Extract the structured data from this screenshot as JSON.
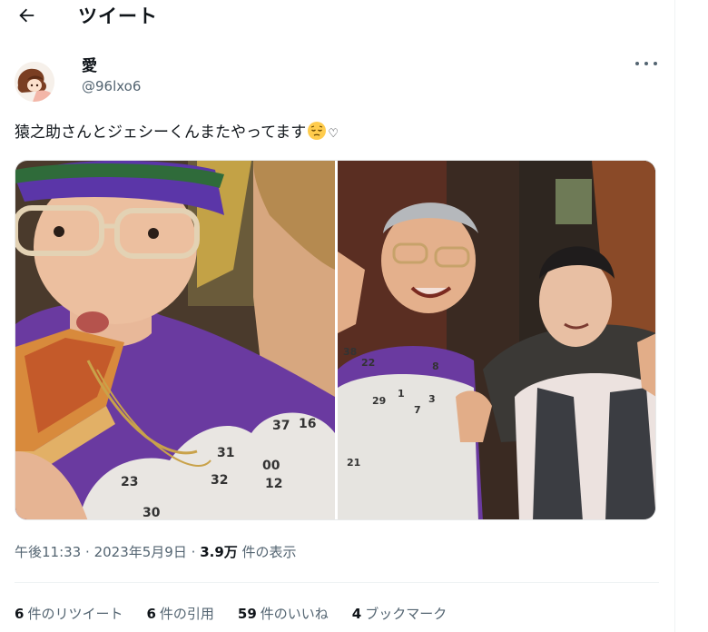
{
  "header": {
    "title": "ツイート",
    "back_icon": "arrow-left-icon"
  },
  "user": {
    "display_name": "愛",
    "handle": "@96lxo6",
    "avatar_icon": "avatar-illustration"
  },
  "tweet": {
    "text": "猿之助さんとジェシーくんまたやってます",
    "emoji": "pensive-face-emoji",
    "heart": "♡"
  },
  "media": {
    "photos": [
      {
        "alt": "photo-left"
      },
      {
        "alt": "photo-right"
      }
    ],
    "sweater_numbers_left": [
      "37",
      "16",
      "31",
      "00",
      "12",
      "23",
      "32",
      "30"
    ],
    "sweater_numbers_right": [
      "38",
      "22",
      "29",
      "7",
      "1",
      "3",
      "21",
      "8"
    ]
  },
  "meta": {
    "time": "午後11:33",
    "sep1": "·",
    "date": "2023年5月9日",
    "sep2": "·",
    "views_value": "3.9万",
    "views_label": "件の表示"
  },
  "stats": {
    "retweets_value": "6",
    "retweets_label": "件のリツイート",
    "quotes_value": "6",
    "quotes_label": "件の引用",
    "likes_value": "59",
    "likes_label": "件のいいね",
    "bookmarks_value": "4",
    "bookmarks_label": "ブックマーク"
  }
}
